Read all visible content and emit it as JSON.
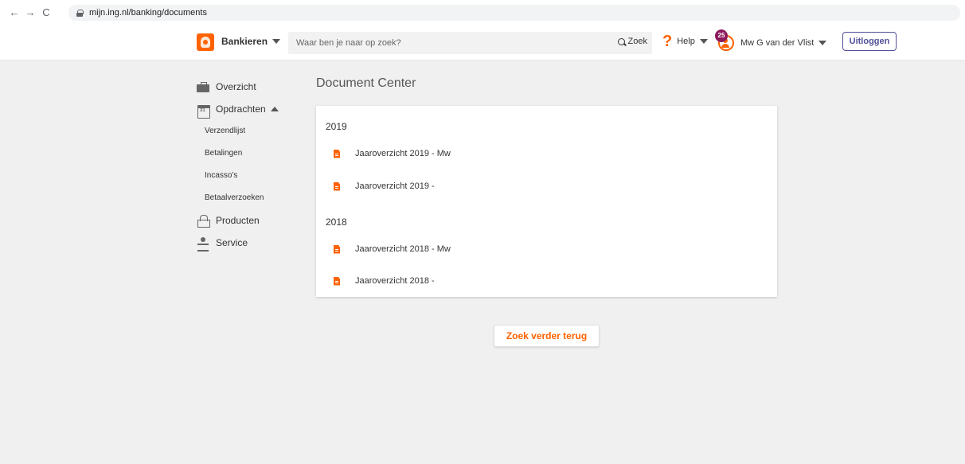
{
  "browser": {
    "url": "mijn.ing.nl/banking/documents",
    "back": "←",
    "forward": "→",
    "reload": "C"
  },
  "header": {
    "menu_label": "Bankieren",
    "search": {
      "placeholder": "Waar ben je naar op zoek?",
      "value": "",
      "button_label": "Zoek"
    },
    "help_label": "Help",
    "notification_count": "25",
    "user_name": "Mw G van der Vlist",
    "logout_label": "Uitloggen",
    "brand_color": "#ff6200"
  },
  "sidebar": {
    "items": [
      {
        "label": "Overzicht",
        "icon": "briefcase-icon"
      },
      {
        "label": "Opdrachten",
        "icon": "calendar-icon"
      },
      {
        "label": "Producten",
        "icon": "basket-icon"
      },
      {
        "label": "Service",
        "icon": "service-person-icon"
      }
    ],
    "subitems": [
      "Verzendlijst",
      "Betalingen",
      "Incasso's",
      "Betaalverzoeken"
    ]
  },
  "main": {
    "title": "Document Center",
    "groups": [
      {
        "year": "2019",
        "docs": [
          "Jaaroverzicht 2019 - Mw",
          "Jaaroverzicht 2019 -"
        ]
      },
      {
        "year": "2018",
        "docs": [
          "Jaaroverzicht 2018 - Mw",
          "Jaaroverzicht 2018 -"
        ]
      }
    ],
    "more_button_label": "Zoek verder terug"
  }
}
